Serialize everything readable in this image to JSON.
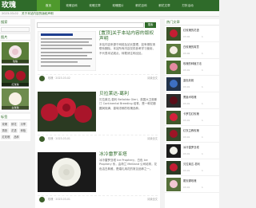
{
  "site": {
    "logo_text": "玫瑰"
  },
  "nav": {
    "items": [
      {
        "label": "首页"
      },
      {
        "label": "玫瑰百科"
      },
      {
        "label": "玫瑰文章"
      },
      {
        "label": "玫瑰图片"
      },
      {
        "label": "鲜花百科"
      },
      {
        "label": "鲜花文章"
      },
      {
        "label": "打折活动"
      }
    ]
  },
  "ticker": {
    "date": "2023-03-02",
    "text": "关于本站内容的版权声明"
  },
  "left": {
    "search_title": "搜索",
    "gallery_title": "图片",
    "captions": [
      "玫瑰",
      "红玫瑰",
      "白玫瑰"
    ],
    "tags_title": "标签",
    "tags": [
      "玫瑰",
      "鲜花",
      "月季",
      "蔷薇",
      "花语",
      "种植",
      "红玫瑰",
      "品种"
    ]
  },
  "main": {
    "search_placeholder": "",
    "search_button": "搜索",
    "posts": [
      {
        "title": "[置顶]关于本站内容的版权声明",
        "excerpt": "本站内容来源于网络及站长整理，如有侵权请联系删除。本站所有内容仅供参考学习使用，不代表本站观点，转载请注明出处。",
        "author": "玫瑰",
        "date": "2023-03-02",
        "readmore": "阅读全文"
      },
      {
        "title": "贝拉莱达-葛利",
        "excerpt": "贝拉莱达-葛利 Bellalida Gleri，英国大卫奥斯汀 Continental Breeding 培育，是一种花瓣圆润饱满、香味浓郁的玫瑰品种。",
        "author": "玫瑰",
        "date": "2023-03-01",
        "readmore": "阅读全文"
      },
      {
        "title": "冰冷雷罗亚塔",
        "excerpt": "冰冷雷罗亚塔 Ice Prophery，白色 Ice Prophery 系，由荷兰 Meilland 公司培育，花色洁白典雅，是婚礼用花的常见品种之一。",
        "author": "玫瑰",
        "date": "2023-03-01",
        "readmore": "阅读全文"
      }
    ]
  },
  "right": {
    "title": "热门文章",
    "items": [
      {
        "title": "红玫瑰的花语",
        "date": "03-02",
        "views": "1"
      },
      {
        "title": "白玫瑰的寓意",
        "date": "03-02",
        "views": "1"
      },
      {
        "title": "玫瑰的种植方法",
        "date": "03-01",
        "views": "1"
      },
      {
        "title": "蓝色妖姬",
        "date": "03-01",
        "views": "1"
      },
      {
        "title": "黑魔术玫瑰",
        "date": "03-01",
        "views": "1"
      },
      {
        "title": "卡罗拉红玫瑰",
        "date": "03-01",
        "views": "1"
      },
      {
        "title": "红衣主教玫瑰",
        "date": "03-01",
        "views": "1"
      },
      {
        "title": "冰冷雷罗亚塔",
        "date": "03-01",
        "views": "1"
      },
      {
        "title": "贝拉莱达-葛利",
        "date": "03-01",
        "views": "1"
      },
      {
        "title": "戴安娜玫瑰",
        "date": "03-01",
        "views": "1"
      }
    ]
  },
  "colors": {
    "brand": "#2f6b2a",
    "accent": "#4f9a2d"
  }
}
